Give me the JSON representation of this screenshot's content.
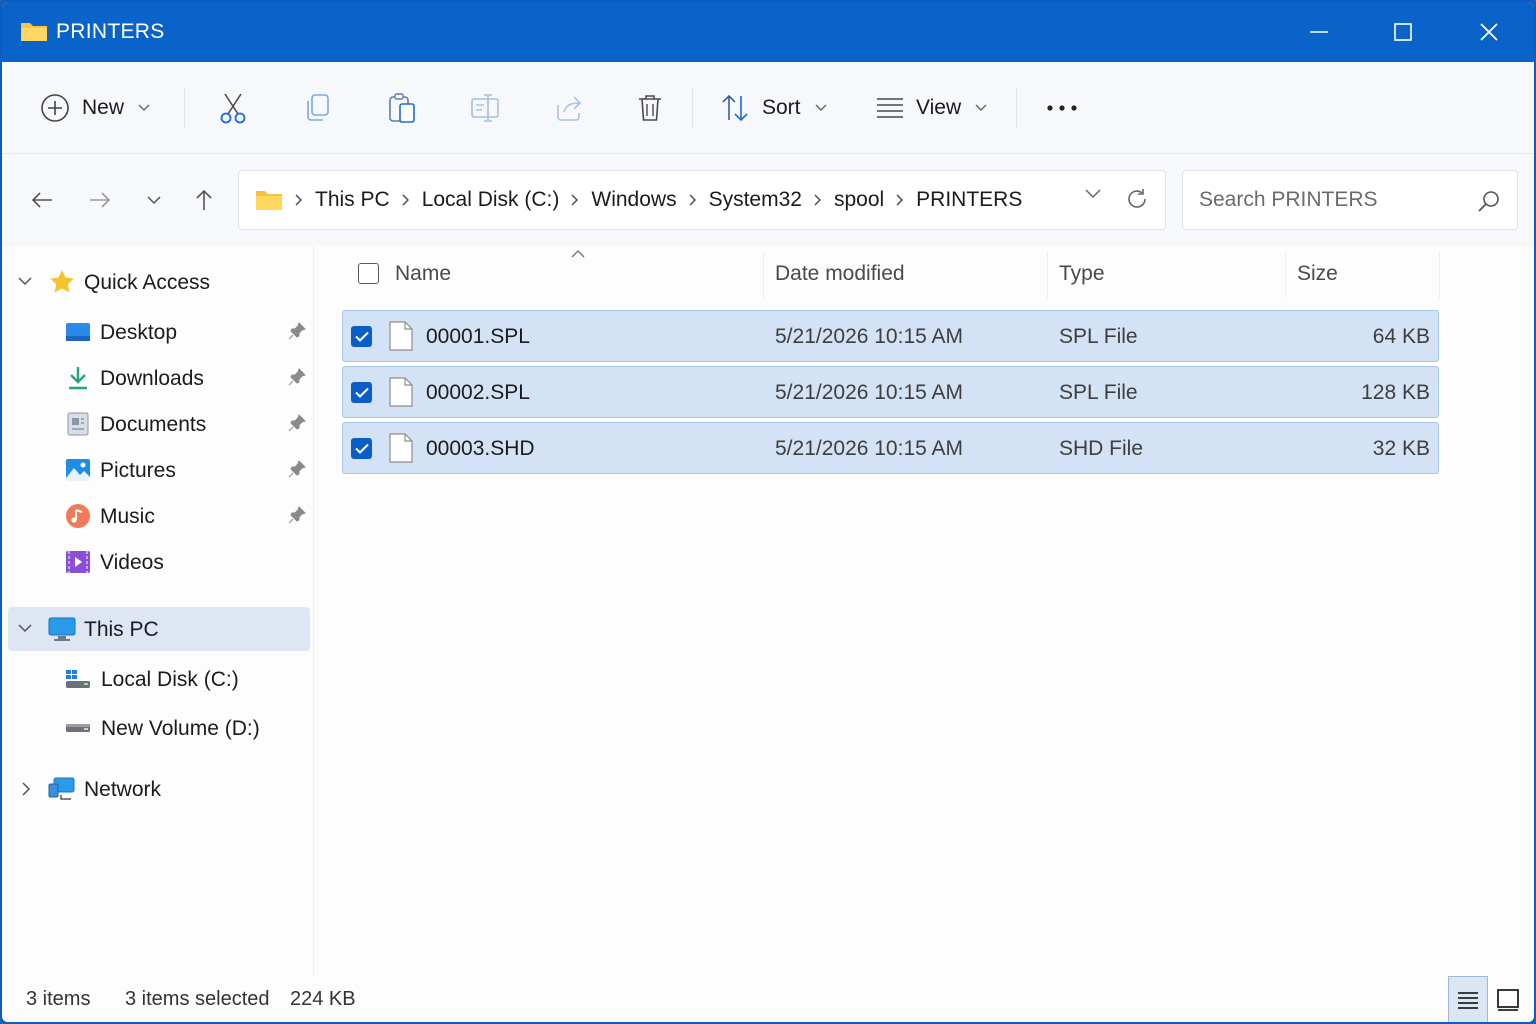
{
  "window": {
    "title": "PRINTERS",
    "accent": "#0a63c9"
  },
  "toolbar": {
    "new_label": "New",
    "sort_label": "Sort",
    "view_label": "View",
    "icons": [
      "new-icon",
      "cut-icon",
      "copy-icon",
      "paste-icon",
      "rename-icon",
      "share-icon",
      "delete-icon",
      "sort-icon",
      "view-icon",
      "more-icon"
    ]
  },
  "address": {
    "crumbs": [
      "This PC",
      "Local Disk (C:)",
      "Windows",
      "System32",
      "spool",
      "PRINTERS"
    ]
  },
  "search": {
    "placeholder": "Search PRINTERS"
  },
  "sidebar": {
    "quick_access": "Quick Access",
    "quick_items": [
      {
        "label": "Desktop",
        "icon": "desktop-icon",
        "pinned": true
      },
      {
        "label": "Downloads",
        "icon": "downloads-icon",
        "pinned": true
      },
      {
        "label": "Documents",
        "icon": "documents-icon",
        "pinned": true
      },
      {
        "label": "Pictures",
        "icon": "pictures-icon",
        "pinned": true
      },
      {
        "label": "Music",
        "icon": "music-icon",
        "pinned": true
      },
      {
        "label": "Videos",
        "icon": "videos-icon",
        "pinned": false
      }
    ],
    "this_pc": "This PC",
    "drives": [
      {
        "label": "Local Disk (C:)",
        "icon": "local-disk-icon"
      },
      {
        "label": "New Volume (D:)",
        "icon": "drive-icon"
      }
    ],
    "network": "Network"
  },
  "columns": {
    "name": "Name",
    "date": "Date modified",
    "type": "Type",
    "size": "Size"
  },
  "files": [
    {
      "name": "00001.SPL",
      "date": "5/21/2026 10:15 AM",
      "type": "SPL File",
      "size": "64 KB",
      "checked": true
    },
    {
      "name": "00002.SPL",
      "date": "5/21/2026 10:15 AM",
      "type": "SPL File",
      "size": "128 KB",
      "checked": true
    },
    {
      "name": "00003.SHD",
      "date": "5/21/2026 10:15 AM",
      "type": "SHD File",
      "size": "32 KB",
      "checked": true
    }
  ],
  "status": {
    "items": "3 items",
    "selected": "3 items selected",
    "size": "224 KB"
  }
}
